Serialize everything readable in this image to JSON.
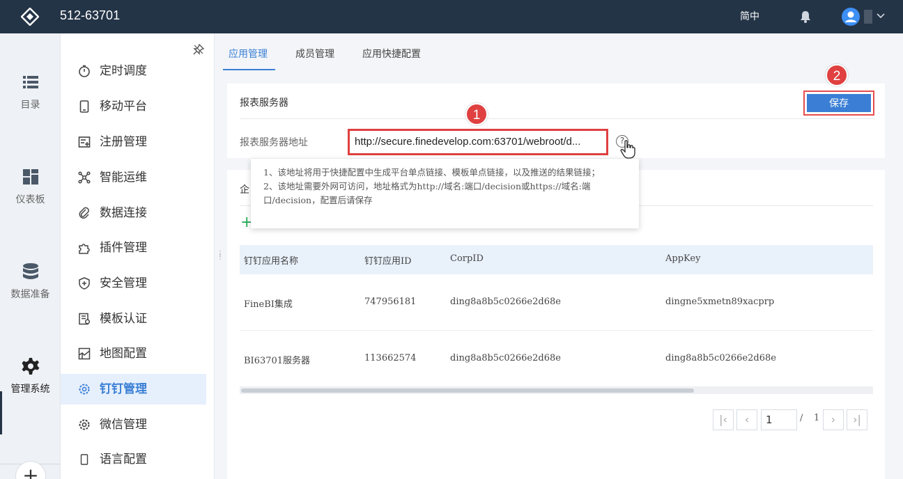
{
  "header": {
    "title": "512-63701",
    "language": "简中",
    "icons": [
      "logo-icon",
      "bell-icon",
      "user-icon",
      "chevron-down-icon"
    ]
  },
  "rail": {
    "items": [
      {
        "label": "目录",
        "icon": "list-icon"
      },
      {
        "label": "仪表板",
        "icon": "dashboard-icon"
      },
      {
        "label": "数据准备",
        "icon": "database-icon"
      },
      {
        "label": "管理系统",
        "icon": "gear-icon",
        "active": true
      }
    ]
  },
  "menu": {
    "items": [
      {
        "label": "定时调度",
        "icon": "timer-icon"
      },
      {
        "label": "移动平台",
        "icon": "mobile-icon"
      },
      {
        "label": "注册管理",
        "icon": "register-icon"
      },
      {
        "label": "智能运维",
        "icon": "network-icon"
      },
      {
        "label": "数据连接",
        "icon": "link-icon"
      },
      {
        "label": "插件管理",
        "icon": "puzzle-icon"
      },
      {
        "label": "安全管理",
        "icon": "shield-icon"
      },
      {
        "label": "模板认证",
        "icon": "template-icon"
      },
      {
        "label": "地图配置",
        "icon": "map-icon"
      },
      {
        "label": "钉钉管理",
        "icon": "gear-icon",
        "active": true
      },
      {
        "label": "微信管理",
        "icon": "gear-icon"
      },
      {
        "label": "语言配置",
        "icon": "language-icon"
      }
    ]
  },
  "tabs": [
    {
      "label": "应用管理",
      "active": true
    },
    {
      "label": "成员管理"
    },
    {
      "label": "应用快捷配置"
    }
  ],
  "server": {
    "section_title": "报表服务器",
    "save_label": "保存",
    "address_label": "报表服务器地址",
    "address_value": "http://secure.finedevelop.com:63701/webroot/d...",
    "help": "?"
  },
  "tooltip": {
    "line1": "1、该地址将用于快捷配置中生成平台单点链接、模板单点链接，以及推送的结果链接；",
    "line2": "2、该地址需要外网可访问，地址格式为http://域名:端口/decision或https://域名:端口/decision，配置后请保存"
  },
  "annotations": {
    "badge1": "1",
    "badge2": "2"
  },
  "apps": {
    "section_title": "企",
    "add_symbol": "+",
    "columns": [
      "钉钉应用名称",
      "钉钉应用ID",
      "CorpID",
      "AppKey"
    ],
    "rows": [
      [
        "FineBI集成",
        "747956181",
        "ding8a8b5c0266e2d68e",
        "dingne5xmetn89xacprp"
      ],
      [
        "BI63701服务器",
        "113662574",
        "ding8a8b5c0266e2d68e",
        "ding8a8b5c0266e2d68e"
      ]
    ]
  },
  "pagination": {
    "current": "1",
    "separator": "/",
    "total": "1",
    "first": "|‹",
    "prev": "‹",
    "next": "›",
    "last": "›|"
  },
  "colors": {
    "accent": "#3a7fd5",
    "header_bg": "#243447",
    "highlight": "#e04040"
  }
}
